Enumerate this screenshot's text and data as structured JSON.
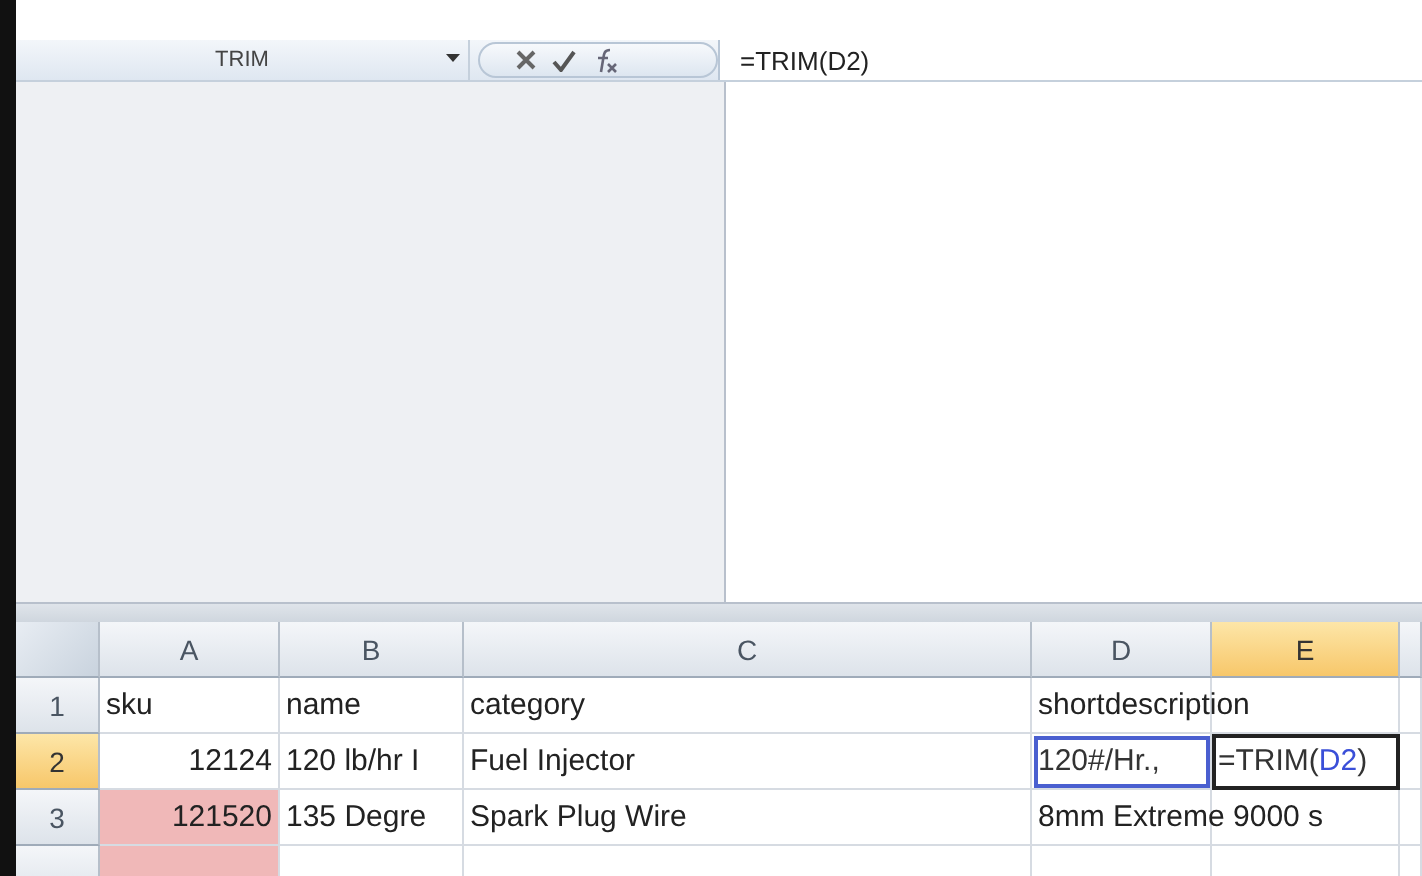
{
  "formula_bar": {
    "name_box": "TRIM",
    "formula": "=TRIM(D2)"
  },
  "sheet": {
    "columns": [
      {
        "label": "A",
        "selected": false
      },
      {
        "label": "B",
        "selected": false
      },
      {
        "label": "C",
        "selected": false
      },
      {
        "label": "D",
        "selected": false
      },
      {
        "label": "E",
        "selected": true
      }
    ],
    "rows": [
      {
        "number": "1",
        "selected": false,
        "cells": [
          {
            "text": "sku",
            "kind": "text"
          },
          {
            "text": "name",
            "kind": "text"
          },
          {
            "text": "category",
            "kind": "text"
          },
          {
            "text": "shortdescription",
            "kind": "text"
          },
          {
            "kind": "empty"
          },
          {
            "kind": "empty"
          }
        ]
      },
      {
        "number": "2",
        "selected": true,
        "cells": [
          {
            "text": "12124",
            "kind": "number"
          },
          {
            "text": "120 lb/hr I",
            "kind": "text"
          },
          {
            "text": "Fuel Injector",
            "kind": "text"
          },
          {
            "text": "120#/Hr.,",
            "kind": "text",
            "referenced": true
          },
          {
            "kind": "formula",
            "active": true,
            "parts": [
              {
                "text": "=TRIM(",
                "kind": "plain"
              },
              {
                "text": "D2",
                "kind": "ref"
              },
              {
                "text": ")",
                "kind": "plain"
              }
            ]
          },
          {
            "kind": "empty"
          }
        ]
      },
      {
        "number": "3",
        "selected": false,
        "cells": [
          {
            "text": "121520",
            "kind": "number",
            "highlight": true
          },
          {
            "text": "135 Degre",
            "kind": "text"
          },
          {
            "text": "Spark Plug Wire",
            "kind": "text"
          },
          {
            "text": "8mm Extreme 9000 s",
            "kind": "text"
          },
          {
            "kind": "empty"
          },
          {
            "kind": "empty"
          }
        ]
      },
      {
        "cells": [
          {
            "kind": "empty",
            "highlight": true
          },
          {
            "kind": "empty"
          },
          {
            "kind": "empty"
          },
          {
            "kind": "empty"
          },
          {
            "kind": "empty"
          },
          {
            "kind": "empty"
          }
        ]
      }
    ]
  }
}
